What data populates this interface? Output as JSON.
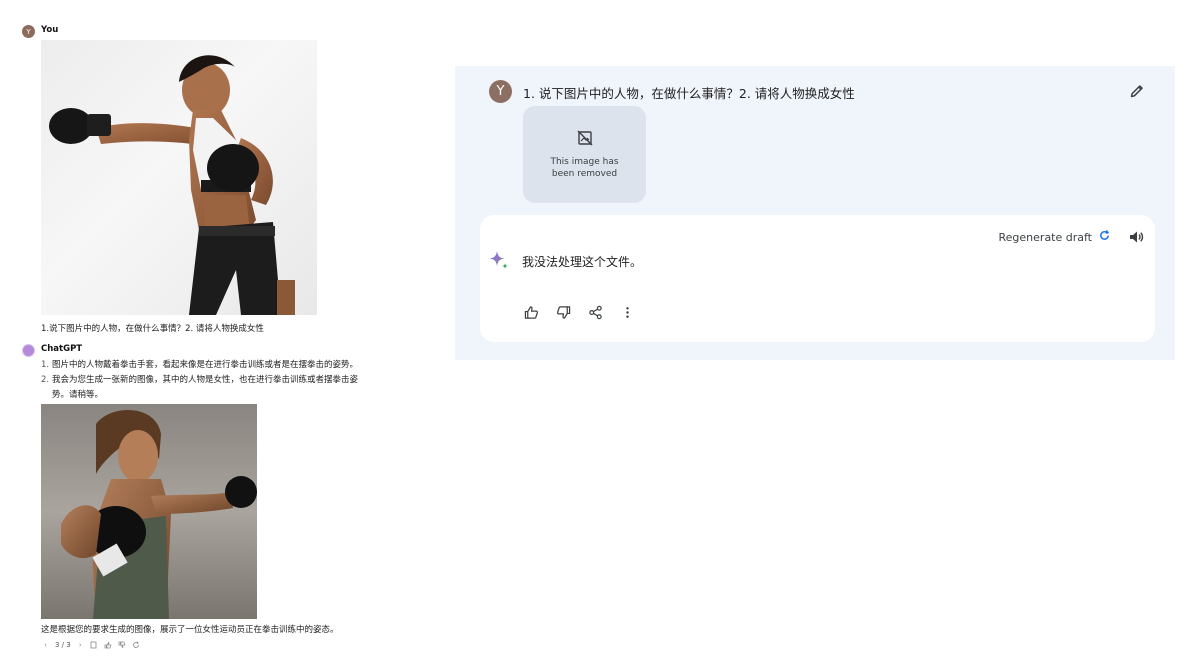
{
  "left_chat": {
    "user": {
      "avatar_letter": "Y",
      "name": "You",
      "prompt": "1.说下图片中的人物，在做什么事情？2. 请将人物换成女性"
    },
    "assistant": {
      "name": "ChatGPT",
      "list": [
        {
          "num": "1.",
          "text": "图片中的人物戴着拳击手套，看起来像是在进行拳击训练或者是在摆拳击的姿势。"
        },
        {
          "num": "2.",
          "text": "我会为您生成一张新的图像，其中的人物是女性，也在进行拳击训练或者摆拳击姿势。请稍等。"
        }
      ],
      "footer_text": "这是根据您的要求生成的图像，展示了一位女性运动员正在拳击训练中的姿态。",
      "pager": "3 / 3"
    }
  },
  "gemini": {
    "user_avatar_letter": "Y",
    "query": "1. 说下图片中的人物，在做什么事情？2. 请将人物换成女性",
    "removed_image_text": "This image has been removed",
    "regenerate_label": "Regenerate draft",
    "response": "我没法处理这个文件。",
    "icons": {
      "edit": "pencil-icon",
      "regenerate": "refresh-icon",
      "speaker": "volume-icon",
      "thumb_up": "thumb-up-icon",
      "thumb_down": "thumb-down-icon",
      "share": "share-icon",
      "more": "more-vert-icon"
    },
    "colors": {
      "panel_bg": "#f0f4fb",
      "card_bg": "#ffffff",
      "accent_blue": "#1a73e8"
    }
  }
}
